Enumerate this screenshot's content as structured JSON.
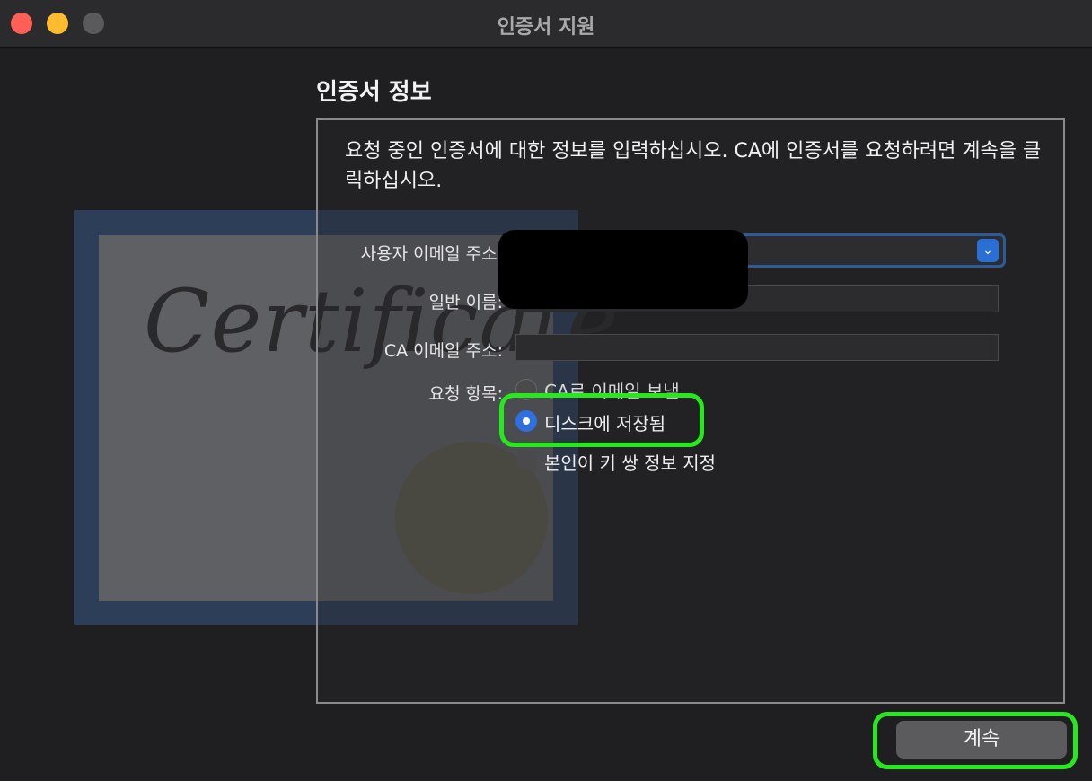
{
  "window": {
    "title": "인증서 지원"
  },
  "section": {
    "title": "인증서 정보"
  },
  "intro": "요청 중인 인증서에 대한 정보를 입력하십시오. CA에 인증서를 요청하려면 계속을 클릭하십시오.",
  "form": {
    "user_email_label": "사용자 이메일 주소:",
    "common_name_label": "일반 이름:",
    "ca_email_label": "CA 이메일 주소:",
    "request_label": "요청 항목:",
    "options": {
      "email_ca": "CA로 이메일 보냄",
      "save_disk": "디스크에 저장됨",
      "key_pair": "본인이 키 쌍 정보 지정"
    }
  },
  "artwork_text": "Certificate",
  "buttons": {
    "continue": "계속"
  }
}
